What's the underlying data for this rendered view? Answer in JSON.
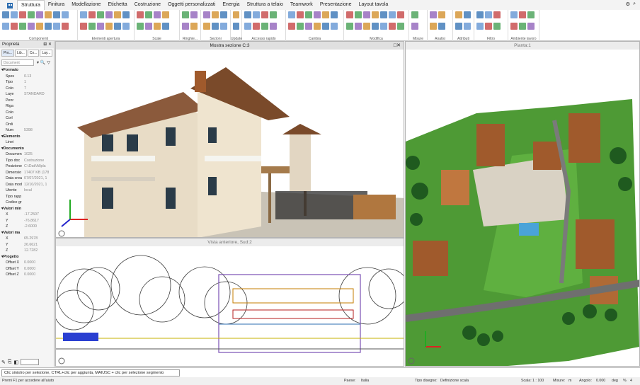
{
  "ribbon_tabs": [
    "Struttura",
    "Finitura",
    "Modellazione",
    "Etichetta",
    "Costruzione",
    "Oggetti personalizzati",
    "Energia",
    "Struttura a telaio",
    "Teamwork",
    "Presentazione",
    "Layout tavola"
  ],
  "active_tab": "Struttura",
  "ribbon_groups": [
    "Componenti",
    "Elementi apertura",
    "Scale",
    "Ringhie...",
    "Sezioni",
    "Update",
    "Accesso rapido",
    "Cambia",
    "Modifica",
    "Misure",
    "Analisi",
    "Attributi",
    "Filtro",
    "Ambiente lavoro"
  ],
  "properties": {
    "title": "Proprietà",
    "tabs": [
      "Pro...",
      "Lib...",
      "Co...",
      "Lay..."
    ],
    "dropdown": "Document",
    "rows": [
      {
        "type": "section",
        "label": "Formato"
      },
      {
        "label": "Spes",
        "value": "0.13"
      },
      {
        "label": "Tipo",
        "value": "1"
      },
      {
        "label": "Colo",
        "value": "7"
      },
      {
        "label": "Laye",
        "value": "STANDARD"
      },
      {
        "label": "Penr",
        "value": ""
      },
      {
        "label": "Riga",
        "value": ""
      },
      {
        "label": "Colo",
        "value": ""
      },
      {
        "label": "Corl",
        "value": ""
      },
      {
        "label": "Ordi",
        "value": ""
      },
      {
        "label": "Num",
        "value": "5398"
      },
      {
        "type": "section",
        "label": "Elemento"
      },
      {
        "label": "Linei",
        "value": ""
      },
      {
        "type": "section",
        "label": "Documento"
      },
      {
        "label": "Documen",
        "value": "1025"
      },
      {
        "label": "Tipo doc",
        "value": "Costruzione"
      },
      {
        "label": "Posizione",
        "value": "C:\\Dati\\Allpla"
      },
      {
        "label": "Dimensio",
        "value": "17407 KB (178"
      },
      {
        "label": "Data crea",
        "value": "07/07/2021, 1"
      },
      {
        "label": "Data mod",
        "value": "12/10/2021, 1"
      },
      {
        "label": "Utente",
        "value": "local"
      },
      {
        "label": "Tipo rapp",
        "value": ""
      },
      {
        "label": "Codice gr",
        "value": ""
      },
      {
        "type": "section",
        "label": "Valori min"
      },
      {
        "label": "X",
        "value": "-17.2507"
      },
      {
        "label": "Y",
        "value": "-76.8617"
      },
      {
        "label": "Z",
        "value": "-2.6000"
      },
      {
        "type": "section",
        "label": "Valori ma"
      },
      {
        "label": "X",
        "value": "65.2978"
      },
      {
        "label": "Y",
        "value": "26.6621"
      },
      {
        "label": "Z",
        "value": "12.7282"
      },
      {
        "type": "section",
        "label": "Progetto"
      },
      {
        "label": "Offset X",
        "value": "0.0000"
      },
      {
        "label": "Offset Y",
        "value": "0.0000"
      },
      {
        "label": "Offset Z",
        "value": "0.0000"
      }
    ]
  },
  "viewports": {
    "perspective": {
      "title": "Mostra sezione C:3"
    },
    "elevation": {
      "title": "Vista anteriore, Sud:2"
    },
    "plan": {
      "title": "Pianta:1"
    }
  },
  "message": "Clic sinistro per selezione, CTRL+clic per aggiunta, MAIUSC + clic per selezione segmento",
  "statusbar": {
    "hint": "Premi F1 per accedere all'aiuto",
    "country_label": "Paese:",
    "country": "Italia",
    "drawing_type_label": "Tipo disegno:",
    "drawing_type": "Definizione scala",
    "scale_label": "Scala:",
    "scale": "1 : 100",
    "length_label": "Misure:",
    "length": "m",
    "angle_label": "Angolo:",
    "angle": "0.000",
    "unit": "deg",
    "percent": "%",
    "extra": "4"
  },
  "colors": {
    "accent": "#2b6cb0",
    "ribbon_bg": "#ffffff",
    "grass": "#4e9a35",
    "roof": "#a05a2c",
    "wall": "#e8dcc6"
  }
}
